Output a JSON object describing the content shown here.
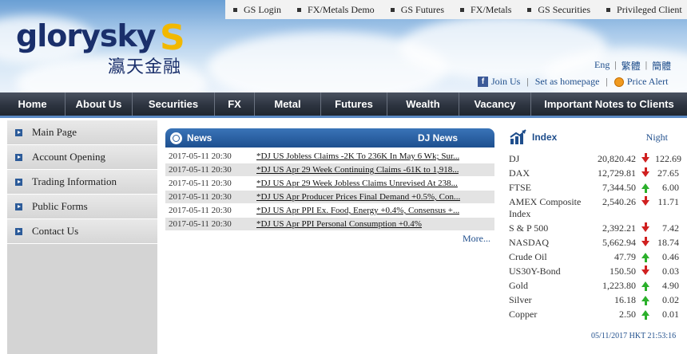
{
  "toplinks": [
    "GS Login",
    "FX/Metals Demo",
    "GS Futures",
    "FX/Metals",
    "GS Securities",
    "Privileged Client"
  ],
  "logo": {
    "text": "glorysky",
    "mark": "S",
    "chinese": "瀛天金融"
  },
  "lang": [
    "Eng",
    "繁體",
    "簡體"
  ],
  "util": {
    "join": "Join Us",
    "homepage": "Set as homepage",
    "alert": "Price Alert"
  },
  "nav": [
    "Home",
    "About Us",
    "Securities",
    "FX",
    "Metal",
    "Futures",
    "Wealth",
    "Vacancy",
    "Important Notes to Clients"
  ],
  "sidebar": [
    "Main Page",
    "Account Opening",
    "Trading Information",
    "Public Forms",
    "Contact Us"
  ],
  "news": {
    "title": "News",
    "source": "DJ News",
    "more": "More...",
    "items": [
      {
        "date": "2017-05-11 20:30",
        "title": "*DJ US Jobless Claims -2K To 236K In May 6 Wk; Sur..."
      },
      {
        "date": "2017-05-11 20:30",
        "title": "*DJ US Apr 29 Week Continuing Claims -61K to 1,918..."
      },
      {
        "date": "2017-05-11 20:30",
        "title": "*DJ US Apr 29 Week Jobless Claims Unrevised At 238..."
      },
      {
        "date": "2017-05-11 20:30",
        "title": "*DJ US Apr Producer Prices Final Demand +0.5%, Con..."
      },
      {
        "date": "2017-05-11 20:30",
        "title": "*DJ US Apr PPI Ex. Food, Energy +0.4%, Consensus +..."
      },
      {
        "date": "2017-05-11 20:30",
        "title": "*DJ US Apr PPI Personal Consumption +0.4%"
      }
    ]
  },
  "index": {
    "title": "Index",
    "night": "Night",
    "timestamp": "05/11/2017 HKT 21:53:16",
    "rows": [
      {
        "name": "DJ",
        "value": "20,820.42",
        "dir": "down",
        "change": "122.69"
      },
      {
        "name": "DAX",
        "value": "12,729.81",
        "dir": "down",
        "change": "27.65"
      },
      {
        "name": "FTSE",
        "value": "7,344.50",
        "dir": "up",
        "change": "6.00"
      },
      {
        "name": "AMEX Composite Index",
        "value": "2,540.26",
        "dir": "down",
        "change": "11.71"
      },
      {
        "name": "S & P 500",
        "value": "2,392.21",
        "dir": "down",
        "change": "7.42"
      },
      {
        "name": "NASDAQ",
        "value": "5,662.94",
        "dir": "down",
        "change": "18.74"
      },
      {
        "name": "Crude Oil",
        "value": "47.79",
        "dir": "up",
        "change": "0.46"
      },
      {
        "name": "US30Y-Bond",
        "value": "150.50",
        "dir": "down",
        "change": "0.03"
      },
      {
        "name": "Gold",
        "value": "1,223.80",
        "dir": "up",
        "change": "4.90"
      },
      {
        "name": "Silver",
        "value": "16.18",
        "dir": "up",
        "change": "0.02"
      },
      {
        "name": "Copper",
        "value": "2.50",
        "dir": "up",
        "change": "0.01"
      }
    ]
  }
}
